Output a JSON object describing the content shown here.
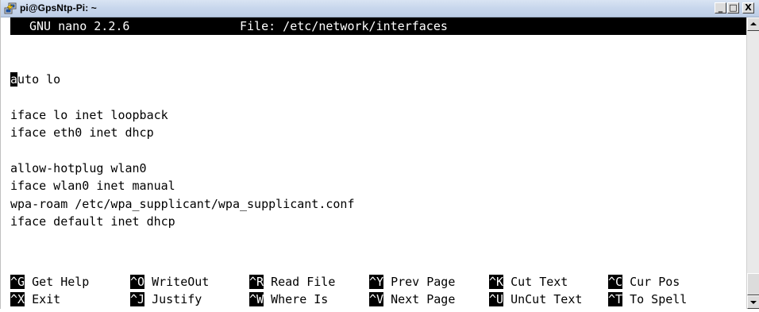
{
  "window": {
    "title": "pi@GpsNtp-Pi: ~",
    "icon": "putty-icon",
    "controls": {
      "minimize": "_",
      "maximize": "□",
      "close": "X"
    }
  },
  "nano": {
    "version": "GNU nano 2.2.6",
    "file": "File: /etc/network/interfaces"
  },
  "content": {
    "cursor_char": "a",
    "line1_rest": "uto lo",
    "line2": "iface lo inet loopback",
    "line3": "iface eth0 inet dhcp",
    "line4": "allow-hotplug wlan0",
    "line5": "iface wlan0 inet manual",
    "line6": "wpa-roam /etc/wpa_supplicant/wpa_supplicant.conf",
    "line7": "iface default inet dhcp"
  },
  "shortcuts": [
    {
      "key": "^G",
      "label": " Get Help"
    },
    {
      "key": "^O",
      "label": " WriteOut"
    },
    {
      "key": "^R",
      "label": " Read File"
    },
    {
      "key": "^Y",
      "label": " Prev Page"
    },
    {
      "key": "^K",
      "label": " Cut Text"
    },
    {
      "key": "^C",
      "label": " Cur Pos"
    },
    {
      "key": "^X",
      "label": " Exit"
    },
    {
      "key": "^J",
      "label": " Justify"
    },
    {
      "key": "^W",
      "label": " Where Is"
    },
    {
      "key": "^V",
      "label": " Next Page"
    },
    {
      "key": "^U",
      "label": " UnCut Text"
    },
    {
      "key": "^T",
      "label": " To Spell"
    }
  ],
  "colors": {
    "terminal_bg": "#ffffff",
    "terminal_fg": "#000000",
    "inverse_bg": "#000000",
    "inverse_fg": "#ffffff"
  }
}
